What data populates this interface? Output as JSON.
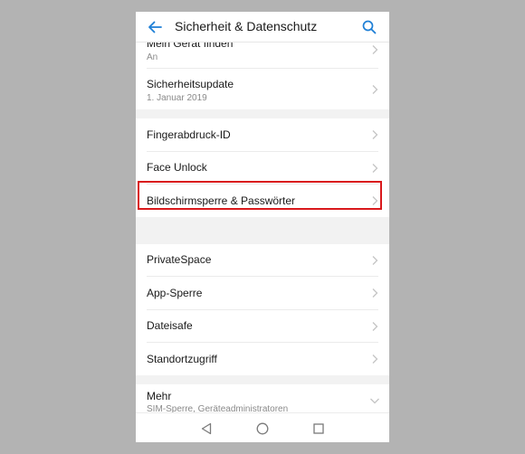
{
  "app_bar": {
    "title": "Sicherheit & Datenschutz",
    "back_icon": "arrow-back-icon",
    "search_icon": "search-icon",
    "accent_color": "#1e7fd6"
  },
  "settings": {
    "section1": [
      {
        "label": "Mein Gerät finden",
        "sub": "An"
      },
      {
        "label": "Sicherheitsupdate",
        "sub": "1. Januar 2019"
      }
    ],
    "section2": [
      {
        "label": "Fingerabdruck-ID"
      },
      {
        "label": "Face Unlock"
      },
      {
        "label": "Bildschirmsperre & Passwörter"
      }
    ],
    "section3": [
      {
        "label": "PrivateSpace"
      },
      {
        "label": "App-Sperre"
      },
      {
        "label": "Dateisafe"
      },
      {
        "label": "Standortzugriff"
      }
    ],
    "more": {
      "label": "Mehr",
      "sub": "SIM-Sperre, Geräteadministratoren"
    }
  },
  "highlight_color": "#d9191c",
  "nav_bar": {
    "back_icon": "triangle-back-icon",
    "home_icon": "circle-home-icon",
    "recents_icon": "square-recents-icon"
  }
}
